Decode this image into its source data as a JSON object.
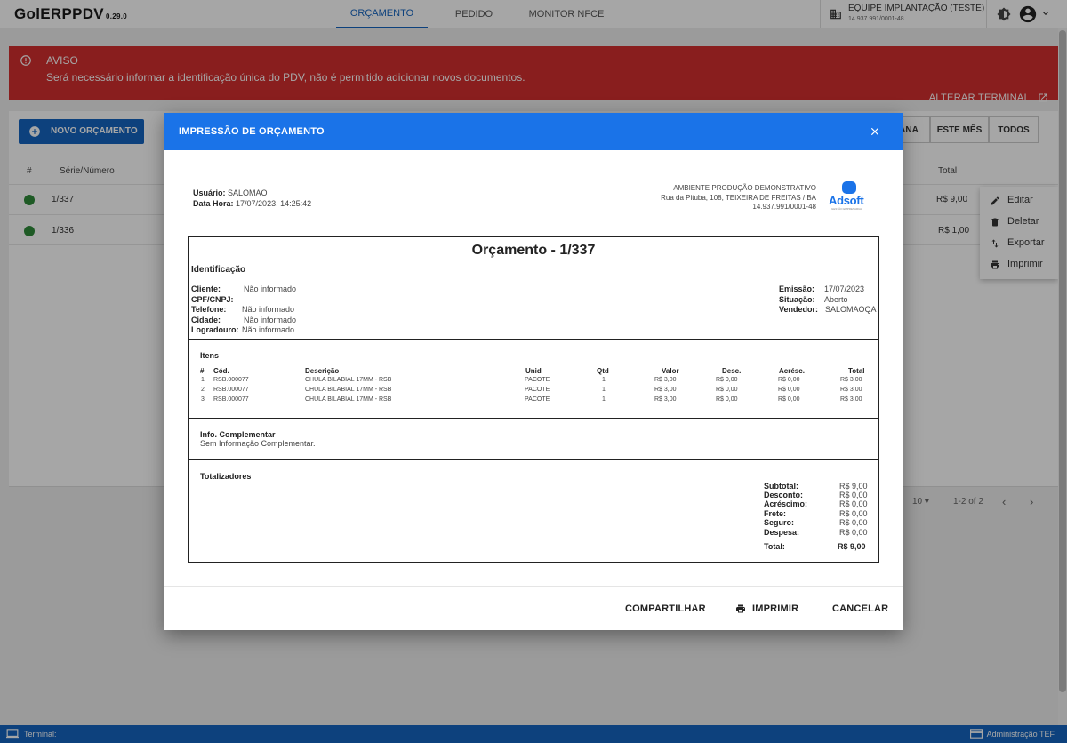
{
  "brand": {
    "name": "GolERPPDV",
    "version": "0.29.0"
  },
  "nav": {
    "tabs": [
      "ORÇAMENTO",
      "PEDIDO",
      "MONITOR NFCE"
    ]
  },
  "company": {
    "name": "EQUIPE IMPLANTAÇÃO (TESTE)",
    "cnpj": "14.937.991/0001-48"
  },
  "alert": {
    "title": "AVISO",
    "message": "Será necessário informar a identificação única do PDV, não é permitido adicionar novos documentos.",
    "action": "ALTERAR TERMINAL"
  },
  "list": {
    "new_button": "NOVO ORÇAMENTO",
    "filters": [
      "ANA",
      "ESTE MÊS",
      "TODOS"
    ],
    "columns": {
      "num": "#",
      "serie": "Série/Número",
      "total": "Total"
    },
    "rows": [
      {
        "serie": "1/337",
        "total": "R$ 9,00"
      },
      {
        "serie": "1/336",
        "total": "R$ 1,00"
      }
    ],
    "per_page": "10",
    "range": "1-2 of 2"
  },
  "context_menu": [
    "Editar",
    "Deletar",
    "Exportar",
    "Imprimir"
  ],
  "modal": {
    "title": "IMPRESSÃO DE ORÇAMENTO",
    "header": {
      "usuario_label": "Usuário:",
      "usuario": "SALOMAO",
      "datahora_label": "Data Hora:",
      "datahora": "17/07/2023, 14:25:42",
      "empresa": "AMBIENTE PRODUÇÃO DEMONSTRATIVO",
      "endereco": "Rua da Pituba, 108, TEIXEIRA DE FREITAS / BA",
      "cnpj": "14.937.991/0001-48",
      "logo_text": "Adsoft",
      "logo_sub": "GESTÃO EMPRESARIAL"
    },
    "doc_title": "Orçamento - 1/337",
    "ident": {
      "heading": "Identificação",
      "left": [
        {
          "label": "Cliente:",
          "value": "Não informado"
        },
        {
          "label": "CPF/CNPJ:",
          "value": ""
        },
        {
          "label": "Telefone:",
          "value": "Não informado"
        },
        {
          "label": "Cidade:",
          "value": "Não informado"
        },
        {
          "label": "Logradouro:",
          "value": "Não informado"
        }
      ],
      "right": [
        {
          "label": "Emissão:",
          "value": "17/07/2023"
        },
        {
          "label": "Situação:",
          "value": "Aberto"
        },
        {
          "label": "Vendedor:",
          "value": "SALOMAOQA"
        }
      ]
    },
    "items": {
      "heading": "Itens",
      "columns": [
        "#",
        "Cód.",
        "Descrição",
        "Unid",
        "Qtd",
        "Valor",
        "Desc.",
        "Acrésc.",
        "Total"
      ],
      "rows": [
        [
          "1",
          "RSB.000077",
          "CHULA BILABIAL 17MM - RSB",
          "PACOTE",
          "1",
          "R$ 3,00",
          "R$ 0,00",
          "R$ 0,00",
          "R$ 3,00"
        ],
        [
          "2",
          "RSB.000077",
          "CHULA BILABIAL 17MM - RSB",
          "PACOTE",
          "1",
          "R$ 3,00",
          "R$ 0,00",
          "R$ 0,00",
          "R$ 3,00"
        ],
        [
          "3",
          "RSB.000077",
          "CHULA BILABIAL 17MM - RSB",
          "PACOTE",
          "1",
          "R$ 3,00",
          "R$ 0,00",
          "R$ 0,00",
          "R$ 3,00"
        ]
      ]
    },
    "info": {
      "heading": "Info. Complementar",
      "text": "Sem Informação Complementar."
    },
    "totals": {
      "heading": "Totalizadores",
      "rows": [
        {
          "label": "Subtotal:",
          "value": "R$ 9,00"
        },
        {
          "label": "Desconto:",
          "value": "R$ 0,00"
        },
        {
          "label": "Acréscimo:",
          "value": "R$ 0,00"
        },
        {
          "label": "Frete:",
          "value": "R$ 0,00"
        },
        {
          "label": "Seguro:",
          "value": "R$ 0,00"
        },
        {
          "label": "Despesa:",
          "value": "R$ 0,00"
        }
      ],
      "total_label": "Total:",
      "total_value": "R$ 9,00"
    },
    "buttons": {
      "share": "COMPARTILHAR",
      "print": "IMPRIMIR",
      "cancel": "CANCELAR"
    }
  },
  "footer": {
    "left": "Terminal:",
    "right": "Administração TEF"
  },
  "colors": {
    "primary": "#1565c0",
    "modal_header": "#1a73e8",
    "alert": "#d32f2f",
    "status_ok": "#2e8b3a"
  }
}
